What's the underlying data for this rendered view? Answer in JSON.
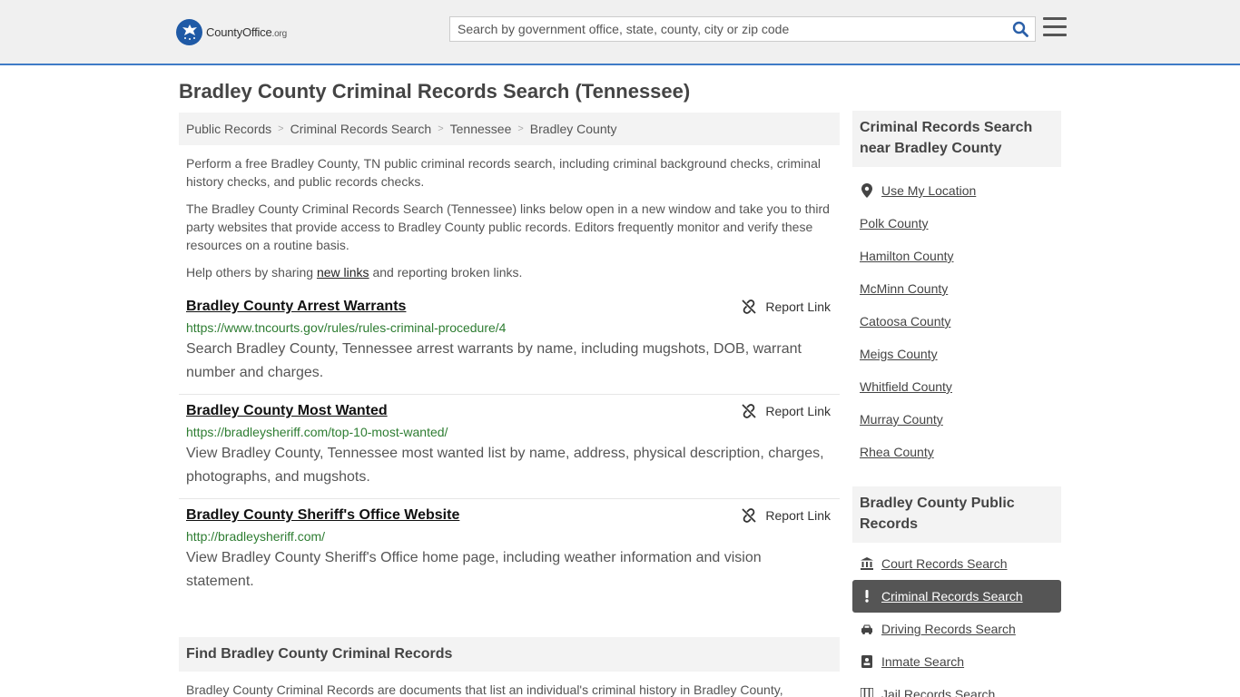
{
  "header": {
    "logo_main": "CountyOffice",
    "logo_tld": ".org",
    "search_placeholder": "Search by government office, state, county, city or zip code"
  },
  "page_title": "Bradley County Criminal Records Search (Tennessee)",
  "breadcrumb": [
    "Public Records",
    "Criminal Records Search",
    "Tennessee",
    "Bradley County"
  ],
  "intro": {
    "p1": "Perform a free Bradley County, TN public criminal records search, including criminal background checks, criminal history checks, and public records checks.",
    "p2": "The Bradley County Criminal Records Search (Tennessee) links below open in a new window and take you to third party websites that provide access to Bradley County public records. Editors frequently monitor and verify these resources on a routine basis.",
    "p3_before": "Help others by sharing ",
    "p3_link": "new links",
    "p3_after": " and reporting broken links."
  },
  "report_label": "Report Link",
  "results": [
    {
      "title": "Bradley County Arrest Warrants",
      "url": "https://www.tncourts.gov/rules/rules-criminal-procedure/4",
      "desc": "Search Bradley County, Tennessee arrest warrants by name, including mugshots, DOB, warrant number and charges."
    },
    {
      "title": "Bradley County Most Wanted",
      "url": "https://bradleysheriff.com/top-10-most-wanted/",
      "desc": "View Bradley County, Tennessee most wanted list by name, address, physical description, charges, photographs, and mugshots."
    },
    {
      "title": "Bradley County Sheriff's Office Website",
      "url": "http://bradleysheriff.com/",
      "desc": "View Bradley County Sheriff's Office home page, including weather information and vision statement."
    }
  ],
  "find_section": {
    "heading": "Find Bradley County Criminal Records",
    "text": "Bradley County Criminal Records are documents that list an individual's criminal history in Bradley County,"
  },
  "sidebar": {
    "nearby_heading": "Criminal Records Search near Bradley County",
    "use_location": "Use My Location",
    "nearby": [
      "Polk County",
      "Hamilton County",
      "McMinn County",
      "Catoosa County",
      "Meigs County",
      "Whitfield County",
      "Murray County",
      "Rhea County"
    ],
    "public_heading": "Bradley County Public Records",
    "public_links": [
      {
        "label": "Court Records Search",
        "icon": "courthouse-icon"
      },
      {
        "label": "Criminal Records Search",
        "icon": "exclamation-icon"
      },
      {
        "label": "Driving Records Search",
        "icon": "car-icon"
      },
      {
        "label": "Inmate Search",
        "icon": "id-badge-icon"
      },
      {
        "label": "Jail Records Search",
        "icon": "jail-icon"
      }
    ]
  },
  "colors": {
    "accent_border": "#3f7bc6",
    "link_green": "#2e7d32",
    "active_bg": "#555555"
  }
}
